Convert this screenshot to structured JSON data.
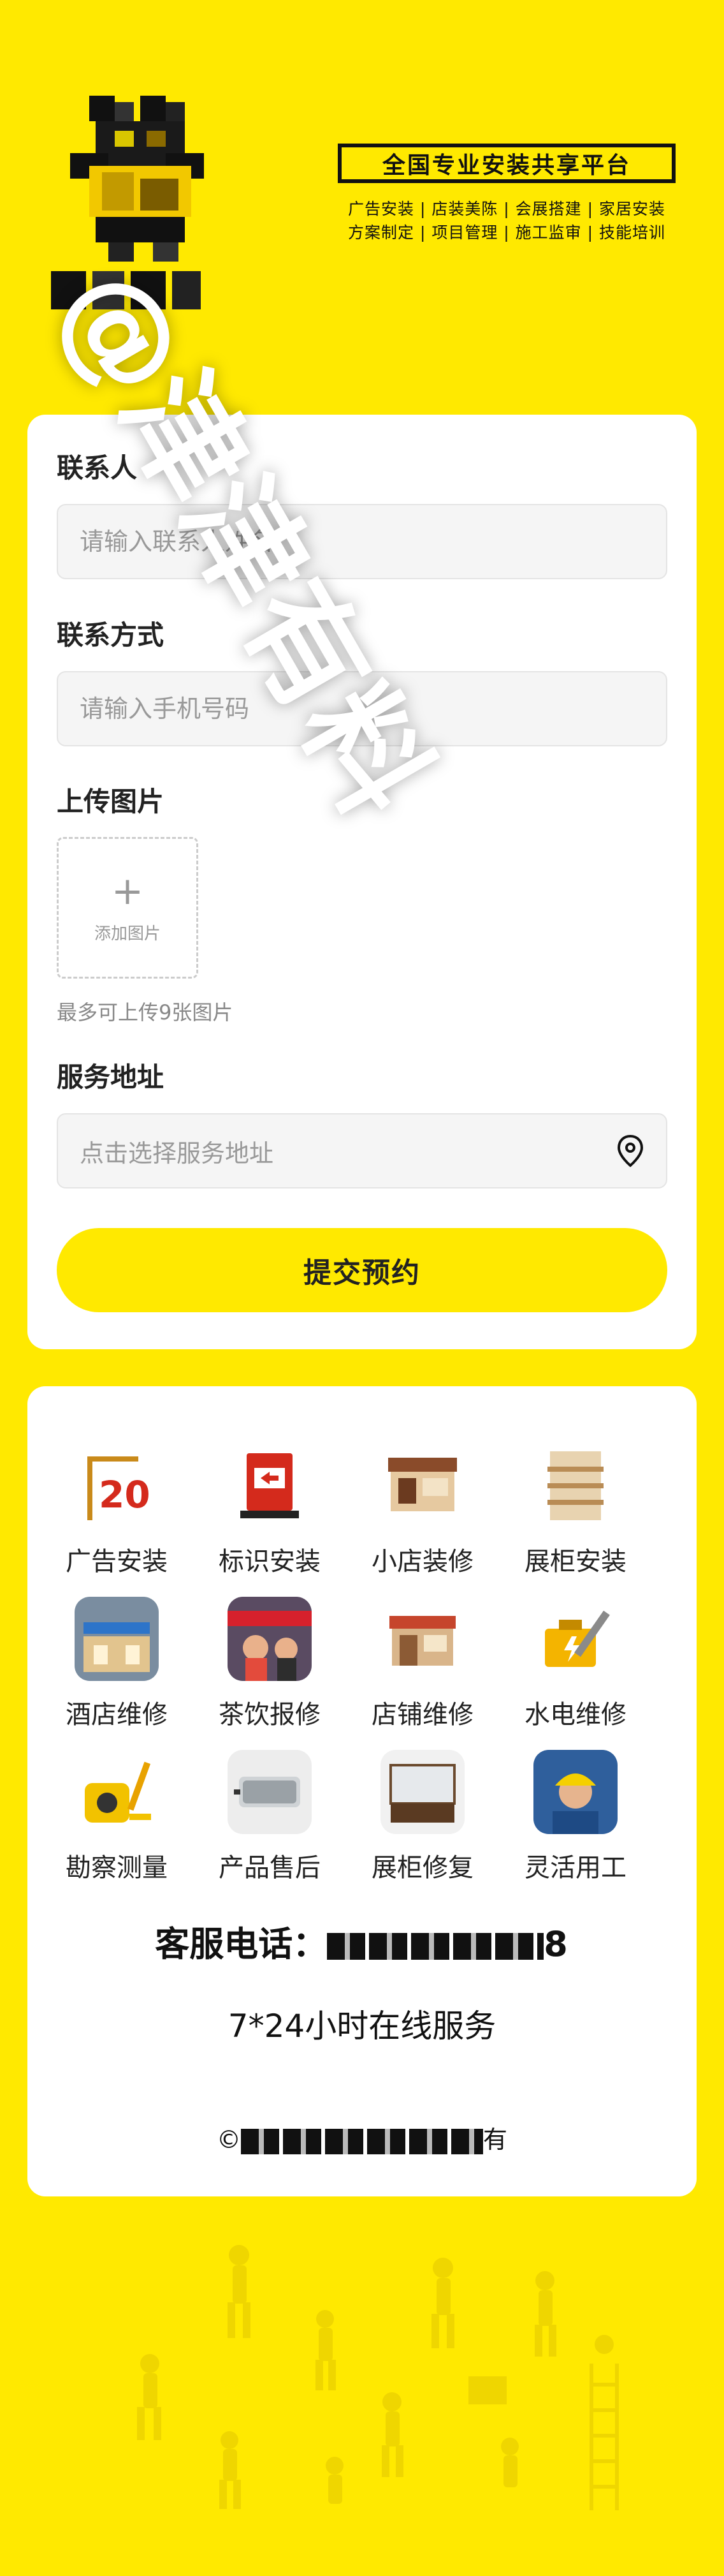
{
  "header": {
    "platform_title": "全国专业安装共享平台",
    "services_line_1": "广告安装 | 店装美陈 | 会展搭建 | 家居安装",
    "services_line_2": "方案制定 | 项目管理 | 施工监审 | 技能培训"
  },
  "watermark": "@津津有料",
  "form": {
    "contact": {
      "label": "联系人",
      "placeholder": "请输入联系人姓名"
    },
    "phone": {
      "label": "联系方式",
      "placeholder": "请输入手机号码"
    },
    "upload": {
      "label": "上传图片",
      "button_text": "添加图片",
      "hint": "最多可上传9张图片"
    },
    "address": {
      "label": "服务地址",
      "placeholder": "点击选择服务地址"
    },
    "submit_label": "提交预约"
  },
  "services": [
    {
      "label": "广告安装",
      "icon": "ad-install-icon"
    },
    {
      "label": "标识安装",
      "icon": "sign-install-icon"
    },
    {
      "label": "小店装修",
      "icon": "shop-decor-icon"
    },
    {
      "label": "展柜安装",
      "icon": "shelf-install-icon"
    },
    {
      "label": "酒店维修",
      "icon": "hotel-repair-icon"
    },
    {
      "label": "茶饮报修",
      "icon": "tea-shop-repair-icon"
    },
    {
      "label": "店铺维修",
      "icon": "store-repair-icon"
    },
    {
      "label": "水电维修",
      "icon": "plumbing-electric-icon"
    },
    {
      "label": "勘察测量",
      "icon": "tape-measure-icon"
    },
    {
      "label": "产品售后",
      "icon": "after-sales-icon"
    },
    {
      "label": "展柜修复",
      "icon": "cabinet-restore-icon"
    },
    {
      "label": "灵活用工",
      "icon": "worker-icon"
    }
  ],
  "hotline": {
    "label": "客服电话：",
    "number_tail": "8"
  },
  "hours": "7*24小时在线服务",
  "copyright": {
    "prefix": "©",
    "suffix": "有"
  }
}
